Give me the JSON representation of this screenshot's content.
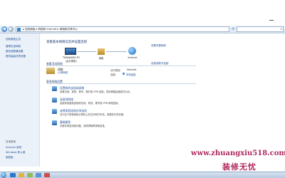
{
  "address": {
    "crumb": "▸ 控制面板 ▸ 网络和 Internet ▸ 网络和共享中心",
    "search_placeholder": ""
  },
  "sidebar": {
    "items": [
      "控制面板主页",
      "管理无线网络",
      "更改适配器设置",
      "更改高级共享设置"
    ],
    "see_also_title": "另请参阅",
    "see_also": [
      "Internet 选项",
      "Windows 防火墙",
      "家庭组"
    ]
  },
  "main": {
    "heading": "查看基本网络信息并设置连接",
    "full_map": "查看完整映射",
    "nodes": {
      "pc_name": "TIANQIANG-PC",
      "pc_sub": "(此计算机)",
      "network": "网络",
      "internet": "Internet"
    },
    "active_title": "查看活动网络",
    "connect_link": "连接或断开连接",
    "network_name": "网络",
    "network_type": "公用网络",
    "access_key": "访问类型:",
    "access_val": "Internet",
    "conn_key": "连接:",
    "conn_val": "本地连接",
    "change_title": "更改网络设置",
    "tasks": [
      {
        "title": "设置新的连接或网络",
        "desc": "设置无线、宽带、拨号、临时或 VPN 连接；或设置路由器或访问点。"
      },
      {
        "title": "连接到网络",
        "desc": "连接到或重新连接到无线、有线、拨号或 VPN 网络连接。"
      },
      {
        "title": "选择家庭组和共享选项",
        "desc": "访问位于其他网络计算机上的文件和打印机，或更改共享设置。"
      },
      {
        "title": "疑难解答",
        "desc": "诊断并修复网络问题，或获得故障排除信息。"
      }
    ]
  },
  "watermark": {
    "url": "www.zhuangxiu518.com",
    "brand": "装修无忧",
    "color": "#b02a5f"
  }
}
